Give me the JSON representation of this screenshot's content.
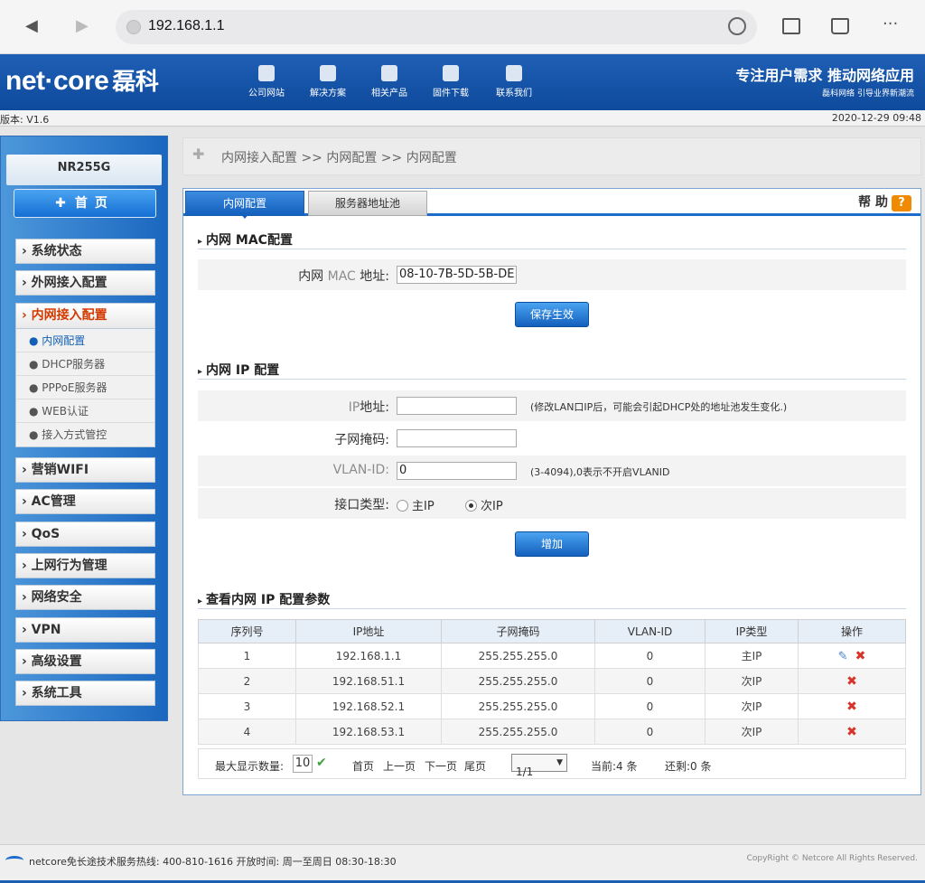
{
  "browser": {
    "url": "192.168.1.1"
  },
  "header": {
    "logo_en": "net·core",
    "logo_cn": "磊科",
    "nav": [
      "公司网站",
      "解决方案",
      "相关产品",
      "固件下载",
      "联系我们"
    ],
    "slogan": "专注用户需求  推动网络应用",
    "slogan_sub": "磊科网络 引导业界新潮流"
  },
  "version": "版本: V1.6",
  "datetime": "2020-12-29 09:48",
  "sidebar": {
    "model": "NR255G",
    "home": "首页",
    "menu": [
      "系统状态",
      "外网接入配置",
      "内网接入配置",
      "营销WIFI",
      "AC管理",
      "QoS",
      "上网行为管理",
      "网络安全",
      "VPN",
      "高级设置",
      "系统工具"
    ],
    "submenu": [
      "内网配置",
      "DHCP服务器",
      "PPPoE服务器",
      "WEB认证",
      "接入方式管控"
    ]
  },
  "breadcrumb": "内网接入配置 >> 内网配置 >> 内网配置",
  "tabs": {
    "tab1": "内网配置",
    "tab2": "服务器地址池",
    "help": "帮 助"
  },
  "mac": {
    "section": "内网 MAC配置",
    "label_a": "内网 ",
    "label_b": "MAC",
    "label_c": " 地址:",
    "value": "08-10-7B-5D-5B-DE",
    "save": "保存生效"
  },
  "ip": {
    "section": "内网 IP 配置",
    "ip_label_a": "IP",
    "ip_label_b": "地址:",
    "ip_value": "",
    "ip_note": "(修改LAN口IP后，可能会引起DHCP处的地址池发生变化.)",
    "mask_label": "子网掩码:",
    "mask_value": "",
    "vlan_label": "VLAN-ID:",
    "vlan_value": "0",
    "vlan_note": "(3-4094),0表示不开启VLANID",
    "type_label": "接口类型:",
    "type_primary": "主IP",
    "type_secondary": "次IP",
    "add": "增加"
  },
  "list": {
    "section": "查看内网 IP 配置参数",
    "headers": [
      "序列号",
      "IP地址",
      "子网掩码",
      "VLAN-ID",
      "IP类型",
      "操作"
    ],
    "rows": [
      [
        "1",
        "192.168.1.1",
        "255.255.255.0",
        "0",
        "主IP"
      ],
      [
        "2",
        "192.168.51.1",
        "255.255.255.0",
        "0",
        "次IP"
      ],
      [
        "3",
        "192.168.52.1",
        "255.255.255.0",
        "0",
        "次IP"
      ],
      [
        "4",
        "192.168.53.1",
        "255.255.255.0",
        "0",
        "次IP"
      ]
    ]
  },
  "pager": {
    "max_label": "最大显示数量:",
    "max_value": "10",
    "first": "首页",
    "prev": "上一页",
    "next": "下一页",
    "last": "尾页",
    "page": "1/1",
    "current": "当前:4 条",
    "remaining": "还剩:0 条"
  },
  "footer": {
    "hotline": "netcore免长途技术服务热线: 400-810-1616  开放时间: 周一至周日 08:30-18:30",
    "copyright": "CopyRight © Netcore All Rights Reserved."
  },
  "colors": {
    "accent": "#1b6ccb",
    "active_menu": "#d23a00",
    "delete": "#d8332a"
  }
}
